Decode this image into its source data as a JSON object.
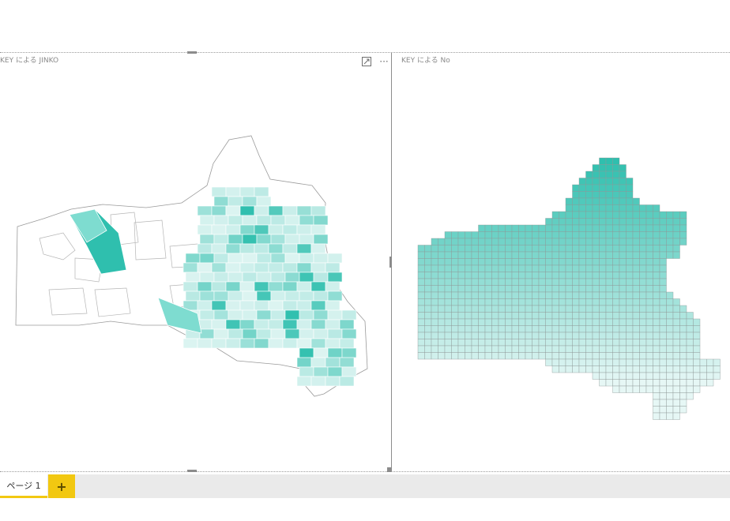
{
  "visuals": {
    "left": {
      "title": "KEY による JINKO"
    },
    "right": {
      "title": "KEY による No"
    }
  },
  "header_icons": {
    "focus_icon": "focus-mode-icon",
    "more_icon": "more-options-icon",
    "more_glyph": "···"
  },
  "tabs": [
    {
      "label": "ページ 1",
      "selected": true
    }
  ],
  "add_tab": {
    "label": "+"
  },
  "colors": {
    "accent": "#f2c811",
    "map_dark": "#2fbfae",
    "map_mid": "#7edcd0",
    "map_light": "#e6f7f5",
    "outline": "#9a9a9a"
  }
}
